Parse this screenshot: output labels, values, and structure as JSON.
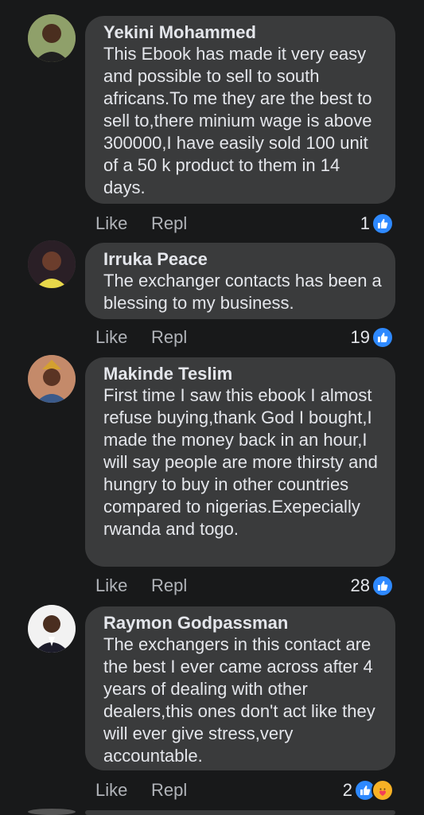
{
  "comments": [
    {
      "author": "Yekini Mohammed",
      "text": "This Ebook has made it very easy and possible to sell to south africans.To me they are the best to sell to,there minium wage is above 300000,I have easily sold 100 unit of a 50 k product to them in 14 days.",
      "like_label": "Like",
      "reply_label": "Repl",
      "reaction_count": "1",
      "reactions": [
        "like-icon"
      ]
    },
    {
      "author": "Irruka Peace",
      "text": "The exchanger contacts has been a blessing to my business.",
      "like_label": "Like",
      "reply_label": "Repl",
      "reaction_count": "19",
      "reactions": [
        "like-icon"
      ]
    },
    {
      "author": "Makinde Teslim",
      "text": "First time I saw this ebook I almost refuse buying,thank God I bought,I made the money back in an hour,I will say people are more thirsty and hungry to buy in other countries compared to nigerias.Exepecially rwanda and togo.",
      "like_label": "Like",
      "reply_label": "Repl",
      "reaction_count": "28",
      "reactions": [
        "like-icon"
      ]
    },
    {
      "author": "Raymon Godpassman",
      "text": "The exchangers in this contact are the best I ever came across after 4 years of dealing with other dealers,this ones don't act like they will ever give stress,very accountable.",
      "like_label": "Like",
      "reply_label": "Repl",
      "reaction_count": "2",
      "reactions": [
        "like-icon",
        "care-icon"
      ]
    }
  ],
  "colors": {
    "background": "#18191a",
    "bubble": "#3a3b3c",
    "text": "#e4e6eb",
    "secondary_text": "#b0b3b8",
    "like_blue": "#2e89ff",
    "care_yellow": "#f7b125"
  }
}
